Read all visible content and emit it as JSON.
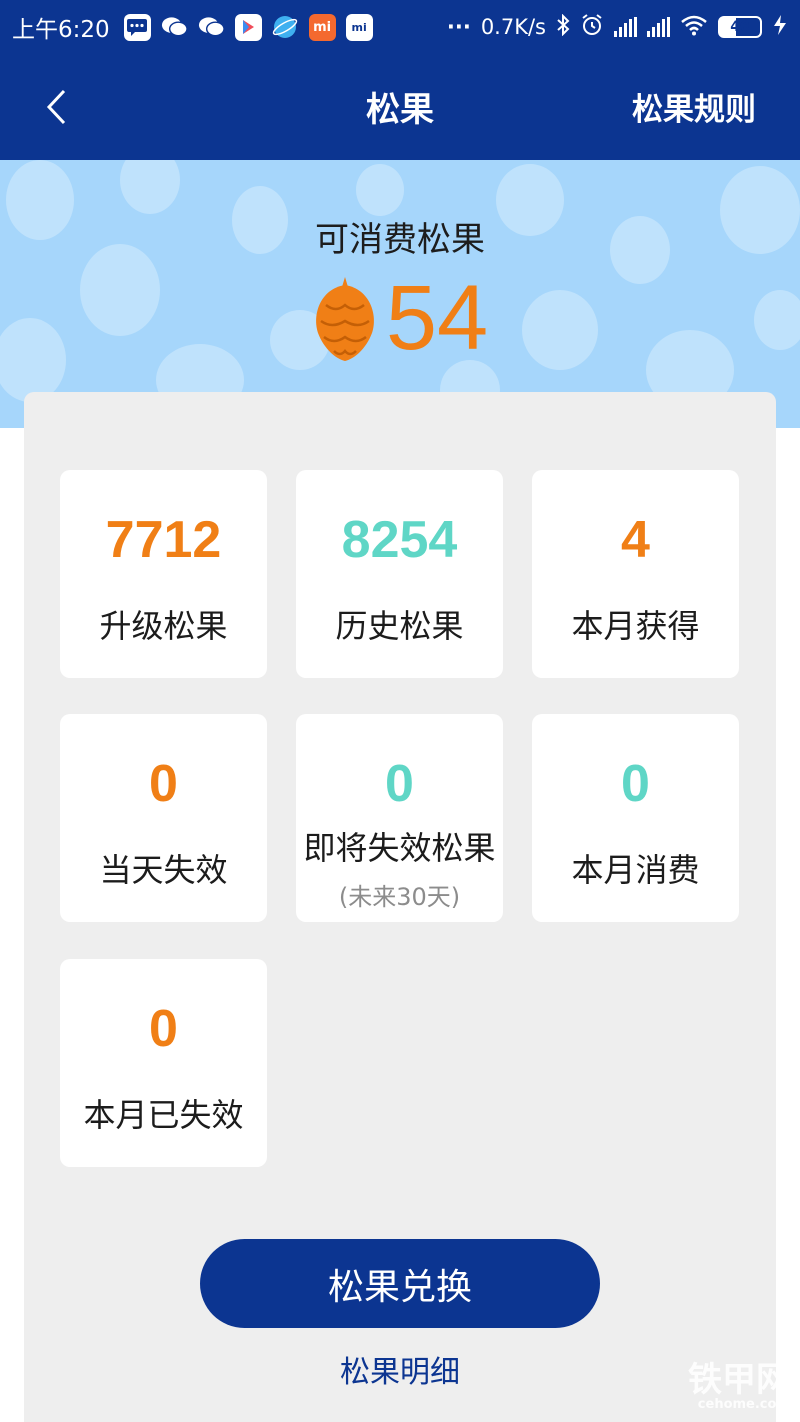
{
  "status_bar": {
    "time": "上午6:20",
    "net_speed": "0.7K/s",
    "battery": "40",
    "app_icons": [
      "message-icon",
      "wechat-icon",
      "wechat-icon",
      "video-play-icon",
      "browser-icon",
      "mi-store-icon",
      "mi-shop-icon"
    ],
    "mi_label": "mi",
    "mi_small": "mi",
    "dots": "···"
  },
  "nav": {
    "title": "松果",
    "rules_label": "松果规则"
  },
  "hero": {
    "label": "可消费松果",
    "value": "54"
  },
  "stats": [
    {
      "value": "7712",
      "label": "升级松果",
      "color": "#f07f16"
    },
    {
      "value": "8254",
      "label": "历史松果",
      "color": "#5fd6c6"
    },
    {
      "value": "4",
      "label": "本月获得",
      "color": "#f07f16"
    },
    {
      "value": "0",
      "label": "当天失效",
      "color": "#f07f16"
    },
    {
      "value": "0",
      "label": "即将失效松果",
      "sublabel": "(未来30天)",
      "color": "#5fd6c6"
    },
    {
      "value": "0",
      "label": "本月消费",
      "color": "#5fd6c6"
    },
    {
      "value": "0",
      "label": "本月已失效",
      "color": "#f07f16"
    }
  ],
  "actions": {
    "exchange_label": "松果兑换",
    "detail_label": "松果明细"
  },
  "watermark": {
    "main": "铁甲网",
    "sub": "cehome.com"
  },
  "colors": {
    "brand_blue": "#0c3591",
    "hero_bg": "#a6d6fb",
    "accent_orange": "#f07f16",
    "accent_teal": "#5fd6c6"
  }
}
